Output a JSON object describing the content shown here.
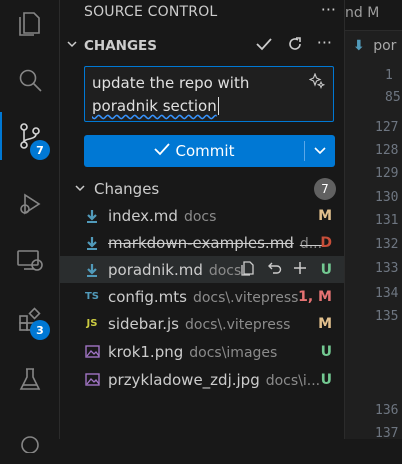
{
  "activity_bar": {
    "items": [
      {
        "name": "explorer-icon"
      },
      {
        "name": "search-icon"
      },
      {
        "name": "source-control-icon",
        "badge": "7"
      },
      {
        "name": "run-debug-icon"
      },
      {
        "name": "remote-explorer-icon"
      },
      {
        "name": "extensions-icon",
        "badge": "3"
      },
      {
        "name": "testing-icon"
      }
    ]
  },
  "sidebar": {
    "title": "SOURCE CONTROL",
    "section_title": "CHANGES",
    "commit_message_line1": "update the repo with",
    "commit_message_line2": "poradnik section",
    "commit_label": "Commit",
    "group_label": "Changes",
    "group_count": "7",
    "files": [
      {
        "name": "index.md",
        "dir": "docs",
        "status": "M",
        "icon": "markdown-icon"
      },
      {
        "name": "markdown-examples.md",
        "dir": "d...",
        "status": "D",
        "icon": "markdown-icon",
        "deleted": true
      },
      {
        "name": "poradnik.md",
        "dir": "docs",
        "status": "U",
        "icon": "markdown-icon"
      },
      {
        "name": "config.mts",
        "dir": "docs\\.vitepress",
        "status": "1, M",
        "icon": "typescript-icon"
      },
      {
        "name": "sidebar.js",
        "dir": "docs\\.vitepress",
        "status": "M",
        "icon": "javascript-icon"
      },
      {
        "name": "krok1.png",
        "dir": "docs\\images",
        "status": "U",
        "icon": "image-icon"
      },
      {
        "name": "przykladowe_zdj.jpg",
        "dir": "docs\\i...",
        "status": "U",
        "icon": "image-icon"
      }
    ]
  },
  "editor": {
    "tab_label": "nd M",
    "breadcrumb": "por",
    "line_numbers": [
      "1",
      "85",
      "127",
      "128",
      "129",
      "130",
      "131",
      "132",
      "133",
      "134",
      "135",
      "136",
      "137"
    ]
  },
  "colors": {
    "accent": "#0078d4",
    "modified": "#e2c08d",
    "deleted": "#c74e39",
    "untracked": "#73c991",
    "error_modified": "#e57373"
  }
}
